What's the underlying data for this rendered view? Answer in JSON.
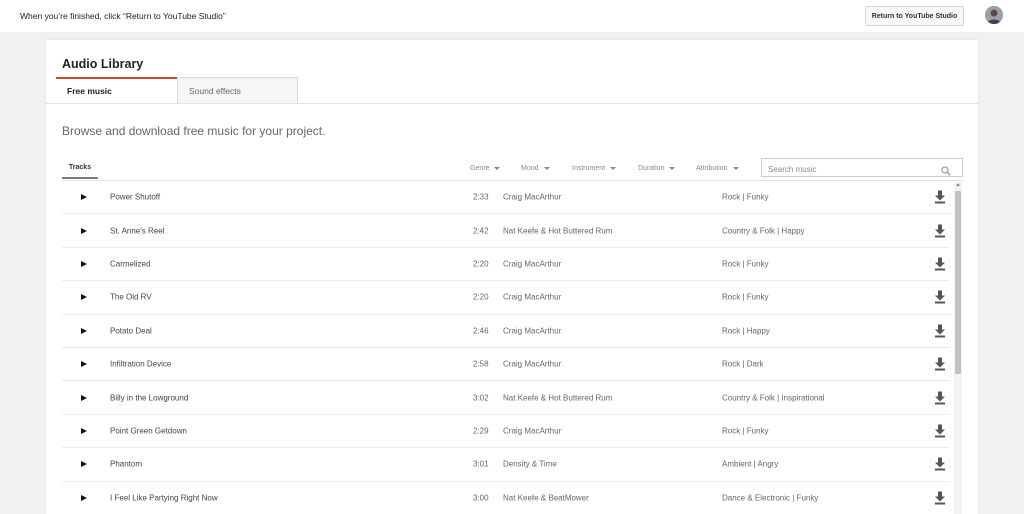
{
  "banner": {
    "notice": "When you’re finished, click “Return to YouTube Studio”",
    "return_label": "Return to YouTube Studio"
  },
  "library": {
    "title": "Audio Library",
    "tabs": [
      {
        "label": "Free music",
        "active": true
      },
      {
        "label": "Sound effects",
        "active": false
      }
    ],
    "subtitle": "Browse and download free music for your project."
  },
  "filters": {
    "tracks_label": "Tracks",
    "items": [
      "Genre",
      "Mood",
      "Instrument",
      "Duration",
      "Attribution"
    ],
    "search_placeholder": "Search music"
  },
  "tracks": [
    {
      "name": "Power Shutoff",
      "duration": "2:33",
      "artist": "Craig MacArthur",
      "genre": "Rock | Funky"
    },
    {
      "name": "St. Anne's Reel",
      "duration": "2:42",
      "artist": "Nat Keefe & Hot Buttered Rum",
      "genre": "Country & Folk | Happy"
    },
    {
      "name": "Carmelized",
      "duration": "2:20",
      "artist": "Craig MacArthur",
      "genre": "Rock | Funky"
    },
    {
      "name": "The Old RV",
      "duration": "2:20",
      "artist": "Craig MacArthur",
      "genre": "Rock | Funky"
    },
    {
      "name": "Potato Deal",
      "duration": "2:46",
      "artist": "Craig MacArthur",
      "genre": "Rock | Happy"
    },
    {
      "name": "Infiltration Device",
      "duration": "2:58",
      "artist": "Craig MacArthur",
      "genre": "Rock | Dark"
    },
    {
      "name": "Billy in the Lowground",
      "duration": "3:02",
      "artist": "Nat Keefe & Hot Buttered Rum",
      "genre": "Country & Folk | Inspirational"
    },
    {
      "name": "Point Green Getdown",
      "duration": "2:29",
      "artist": "Craig MacArthur",
      "genre": "Rock | Funky"
    },
    {
      "name": "Phantom",
      "duration": "3:01",
      "artist": "Density & Time",
      "genre": "Ambient | Angry"
    },
    {
      "name": "I Feel Like Partying Right Now",
      "duration": "3:00",
      "artist": "Nat Keefe & BeatMower",
      "genre": "Dance & Electronic | Funky"
    }
  ],
  "colors": {
    "accent": "#cc4b2d",
    "background": "#f1f1f1"
  },
  "icons": {
    "play": "play-icon",
    "download": "download-icon",
    "search": "search-icon"
  }
}
